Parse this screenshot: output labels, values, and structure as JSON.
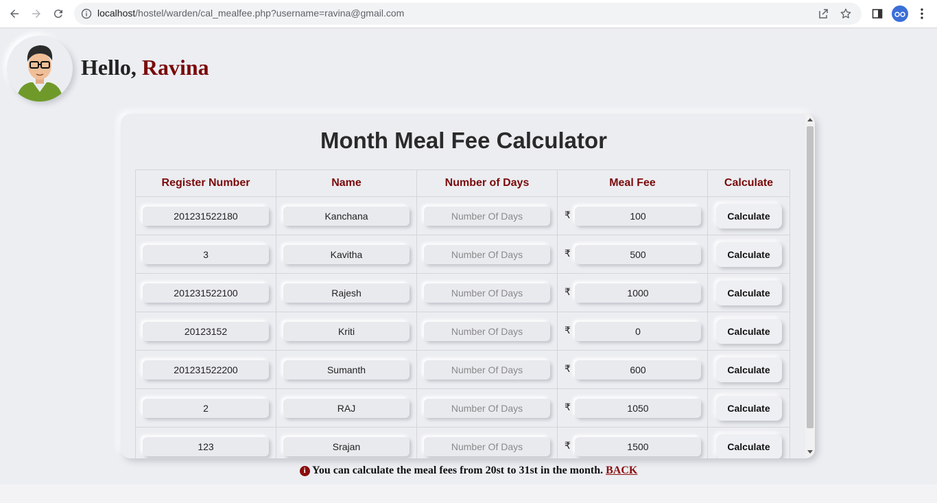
{
  "browser": {
    "url_host": "localhost",
    "url_path": "/hostel/warden/cal_mealfee.php?username=ravina@gmail.com"
  },
  "header": {
    "greeting": "Hello, ",
    "username": "Ravina"
  },
  "calculator": {
    "title": "Month Meal Fee Calculator",
    "columns": [
      "Register Number",
      "Name",
      "Number of Days",
      "Meal Fee",
      "Calculate"
    ],
    "days_placeholder": "Number Of Days",
    "currency_symbol": "₹",
    "calculate_label": "Calculate",
    "rows": [
      {
        "reg": "201231522180",
        "name": "Kanchana",
        "fee": "100"
      },
      {
        "reg": "3",
        "name": "Kavitha",
        "fee": "500"
      },
      {
        "reg": "201231522100",
        "name": "Rajesh",
        "fee": "1000"
      },
      {
        "reg": "20123152",
        "name": "Kriti",
        "fee": "0"
      },
      {
        "reg": "201231522200",
        "name": "Sumanth",
        "fee": "600"
      },
      {
        "reg": "2",
        "name": "RAJ",
        "fee": "1050"
      },
      {
        "reg": "123",
        "name": "Srajan",
        "fee": "1500"
      }
    ]
  },
  "notice": {
    "text": "You can calculate the meal fees from 20st to 31st in the month. ",
    "back_label": "BACK"
  },
  "colors": {
    "accent": "#7a0a0a",
    "page_bg": "#eceef2"
  }
}
